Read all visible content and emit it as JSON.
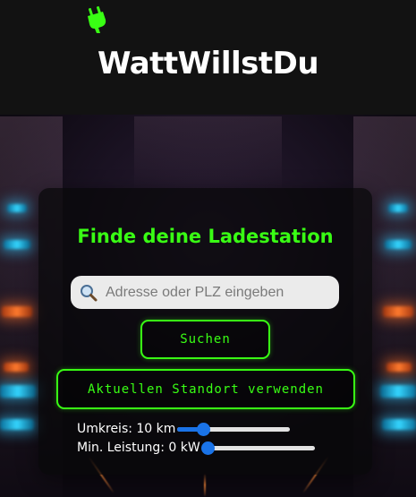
{
  "brand": {
    "name": "WattWillstDu",
    "accent_color": "#39ff14",
    "icon": "plug-icon"
  },
  "card": {
    "title": "Finde deine Ladestation",
    "search": {
      "placeholder": "Adresse oder PLZ eingeben",
      "value": "",
      "icon": "search-icon"
    },
    "search_button": "Suchen",
    "location_button": "Aktuellen Standort verwenden",
    "radius": {
      "label": "Umkreis: 10 km",
      "value_km": 10,
      "level": 0.23
    },
    "power": {
      "label": "Min. Leistung: 0 kW",
      "value_kw": 0,
      "level": 0.0
    }
  }
}
